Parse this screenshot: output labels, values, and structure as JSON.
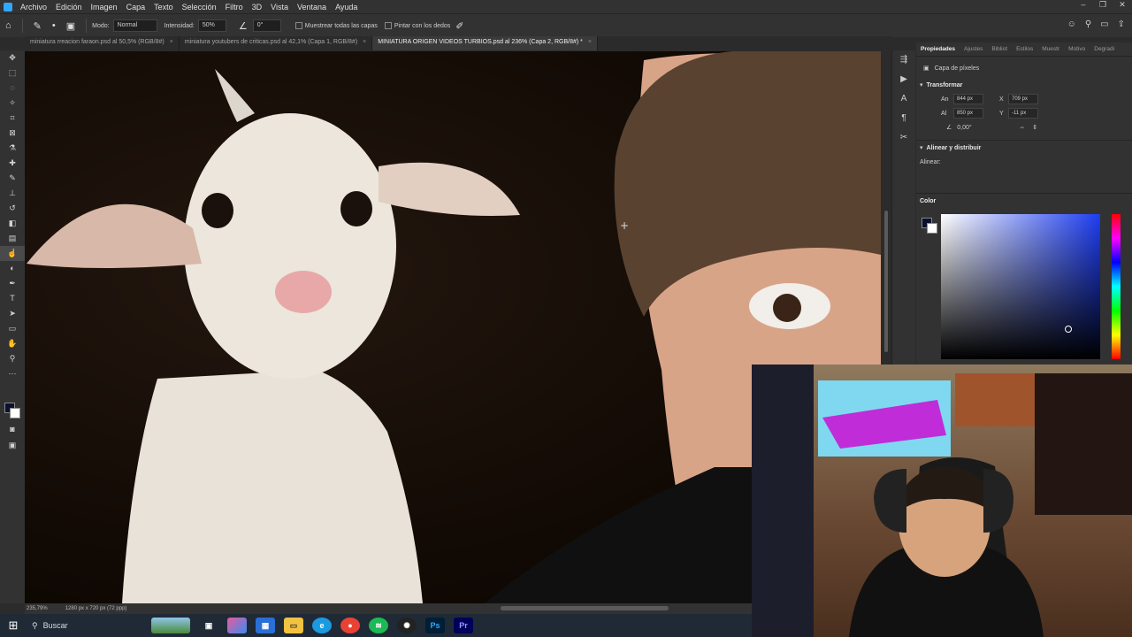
{
  "menu": [
    "Archivo",
    "Edición",
    "Imagen",
    "Capa",
    "Texto",
    "Selección",
    "Filtro",
    "3D",
    "Vista",
    "Ventana",
    "Ayuda"
  ],
  "options": {
    "mode_label": "Modo:",
    "mode_value": "Normal",
    "intensity_label": "Intensidad:",
    "intensity_value": "50%",
    "angle_value": "0°",
    "sample_all_layers": "Muestrear todas las capas",
    "finger_paint": "Pintar con los dedos"
  },
  "tabs": [
    {
      "label": "miniatura rreacion faraon.psd al 50,5% (RGB/8#)"
    },
    {
      "label": "miniatura youtubers de criticas.psd al 42,1% (Capa 1, RGB/8#)"
    },
    {
      "label": "MINIATURA ORIGEN VIDEOS TURBIOS.psd al 236% (Capa 2, RGB/8#) *"
    }
  ],
  "properties": {
    "tabs": [
      "Propiedades",
      "Ajustes",
      "Bibliot",
      "Estilos",
      "Muestr",
      "Motivo",
      "Degradi"
    ],
    "layer_type": "Capa de píxeles",
    "transform_title": "Transformar",
    "w_label": "An",
    "w_value": "844 px",
    "x_label": "X",
    "x_value": "709 px",
    "h_label": "Al",
    "h_value": "850 px",
    "y_label": "Y",
    "y_value": "-11 px",
    "angle_value": "0,00°",
    "align_title": "Alinear y distribuir",
    "align_label": "Alinear:"
  },
  "color_panel": {
    "title": "Color",
    "foreground": "#0c0f2e",
    "background": "#ffffff"
  },
  "status": {
    "zoom": "235,79%",
    "doc_size": "1280 px x 720 px (72 ppp)"
  },
  "taskbar": {
    "search_label": "Buscar"
  },
  "colors": {
    "accent": "#31a8ff",
    "ui_bg": "#323232",
    "ui_dark": "#2b2b2b"
  }
}
